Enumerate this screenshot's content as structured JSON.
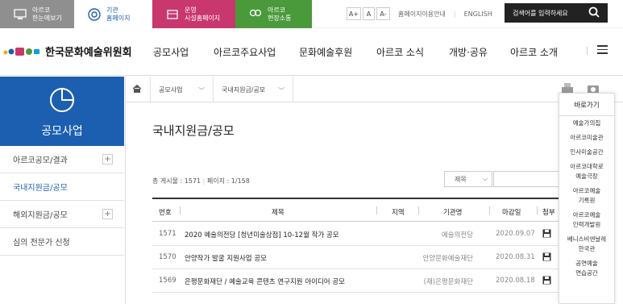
{
  "topbar": {
    "items": [
      {
        "line1": "아르코",
        "line2": "한눈에보기"
      },
      {
        "line1": "기관",
        "line2": "홈페이지"
      },
      {
        "line1": "운영",
        "line2": "시설홈페이지"
      },
      {
        "line1": "아르코",
        "line2": "현장소통"
      }
    ],
    "font_sizes": [
      "A+",
      "A",
      "A-"
    ],
    "guide": "홈페이지이용안내",
    "english": "ENGLISH",
    "search_placeholder": "검색어를 입력하세요",
    "colors": {
      "item1": "#8f8f8f",
      "item3": "#c8376d",
      "item4": "#4a9a3b",
      "search": "#222222"
    }
  },
  "logo": {
    "text": "한국문화예술위원회"
  },
  "nav": [
    "공모사업",
    "아르코주요사업",
    "문화예술후원",
    "아르코 소식",
    "개방·공유",
    "아르코 소개"
  ],
  "lnb": {
    "title": "공모사업",
    "items": [
      {
        "label": "아르코공모/결과",
        "has_plus": true
      },
      {
        "label": "국내지원금/공모",
        "has_plus": false
      },
      {
        "label": "해외지원금/공모",
        "has_plus": true
      },
      {
        "label": "심의 전문가 신청",
        "has_plus": false
      }
    ],
    "accent": "#1c5fb0"
  },
  "breadcrumb": {
    "level1": "공모사업",
    "level2": "국내지원금/공모"
  },
  "page": {
    "title": "국내지원금/공모"
  },
  "board": {
    "total": "총 게시물 : 1571",
    "pages": "페이지 : 1/158",
    "select_value": "제목",
    "headers": [
      "번호",
      "제목",
      "지역",
      "기관명",
      "마감일",
      "첨부"
    ],
    "rows": [
      {
        "no": "1571",
        "title": "2020 예술의전당 [청년미술상점] 10-12월 작가 공모",
        "org": "예술의전당",
        "date": "2020.09.07"
      },
      {
        "no": "1570",
        "title": "안양작가 발굴 지원사업 공모",
        "org": "안양문화예술재단",
        "date": "2020.08.31"
      },
      {
        "no": "1569",
        "title": "은평문화재단 / 예술교육 콘텐츠 연구지원 아이디어 공모",
        "org": "(재)은평문화재단",
        "date": "2020.08.18"
      }
    ]
  },
  "quick": {
    "title": "바로가기",
    "items": [
      "예술가의집",
      "아르코미술관",
      "인사미술공간",
      "아르코대학로\n예술극장",
      "아르코예술\n기록원",
      "아르코예술\n인력개발원",
      "베니스비엔날레\n한국관",
      "공연예술\n연습공간"
    ]
  }
}
